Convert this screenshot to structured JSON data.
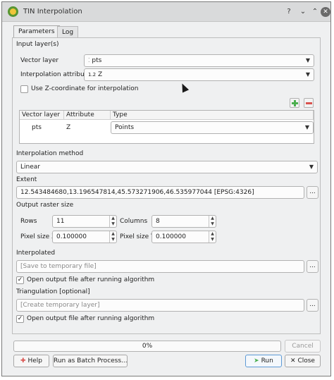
{
  "window": {
    "title": "TIN Interpolation"
  },
  "tabs": [
    {
      "label": "Parameters"
    },
    {
      "label": "Log"
    }
  ],
  "input_layers": {
    "section_label": "Input layer(s)",
    "vector_layer_label": "Vector layer",
    "vector_layer_value": "pts",
    "interpolation_attribute_label": "Interpolation attribute",
    "interpolation_attribute_prefix": "1.2",
    "interpolation_attribute_value": "Z",
    "use_z_label": "Use Z-coordinate for interpolation",
    "use_z_checked": false,
    "table": {
      "headers": [
        "Vector layer",
        "Attribute",
        "Type"
      ],
      "rows": [
        {
          "layer": "pts",
          "attribute": "Z",
          "type": "Points"
        }
      ]
    }
  },
  "interpolation_method": {
    "label": "Interpolation method",
    "value": "Linear"
  },
  "extent": {
    "label": "Extent",
    "value": "12.543484680,13.196547814,45.573271906,46.535977044 [EPSG:4326]"
  },
  "output_raster": {
    "label": "Output raster size",
    "rows_label": "Rows",
    "rows_value": "11",
    "columns_label": "Columns",
    "columns_value": "8",
    "pixel_x_label": "Pixel size X",
    "pixel_x_value": "0.100000",
    "pixel_y_label": "Pixel size Y",
    "pixel_y_value": "0.100000"
  },
  "interpolated": {
    "label": "Interpolated",
    "placeholder": "[Save to temporary file]",
    "open_after_label": "Open output file after running algorithm",
    "open_after_checked": true
  },
  "triangulation": {
    "label": "Triangulation [optional]",
    "placeholder": "[Create temporary layer]",
    "open_after_label": "Open output file after running algorithm",
    "open_after_checked": true
  },
  "progress": {
    "text": "0%",
    "value": 0
  },
  "buttons": {
    "browse": "...",
    "cancel": "Cancel",
    "help": "Help",
    "batch": "Run as Batch Process...",
    "run": "Run",
    "close": "Close"
  },
  "colors": {
    "accent": "#3daee9",
    "add_green": "#4caf50",
    "remove_red": "#d9534f",
    "qgis_green": "#589632"
  }
}
